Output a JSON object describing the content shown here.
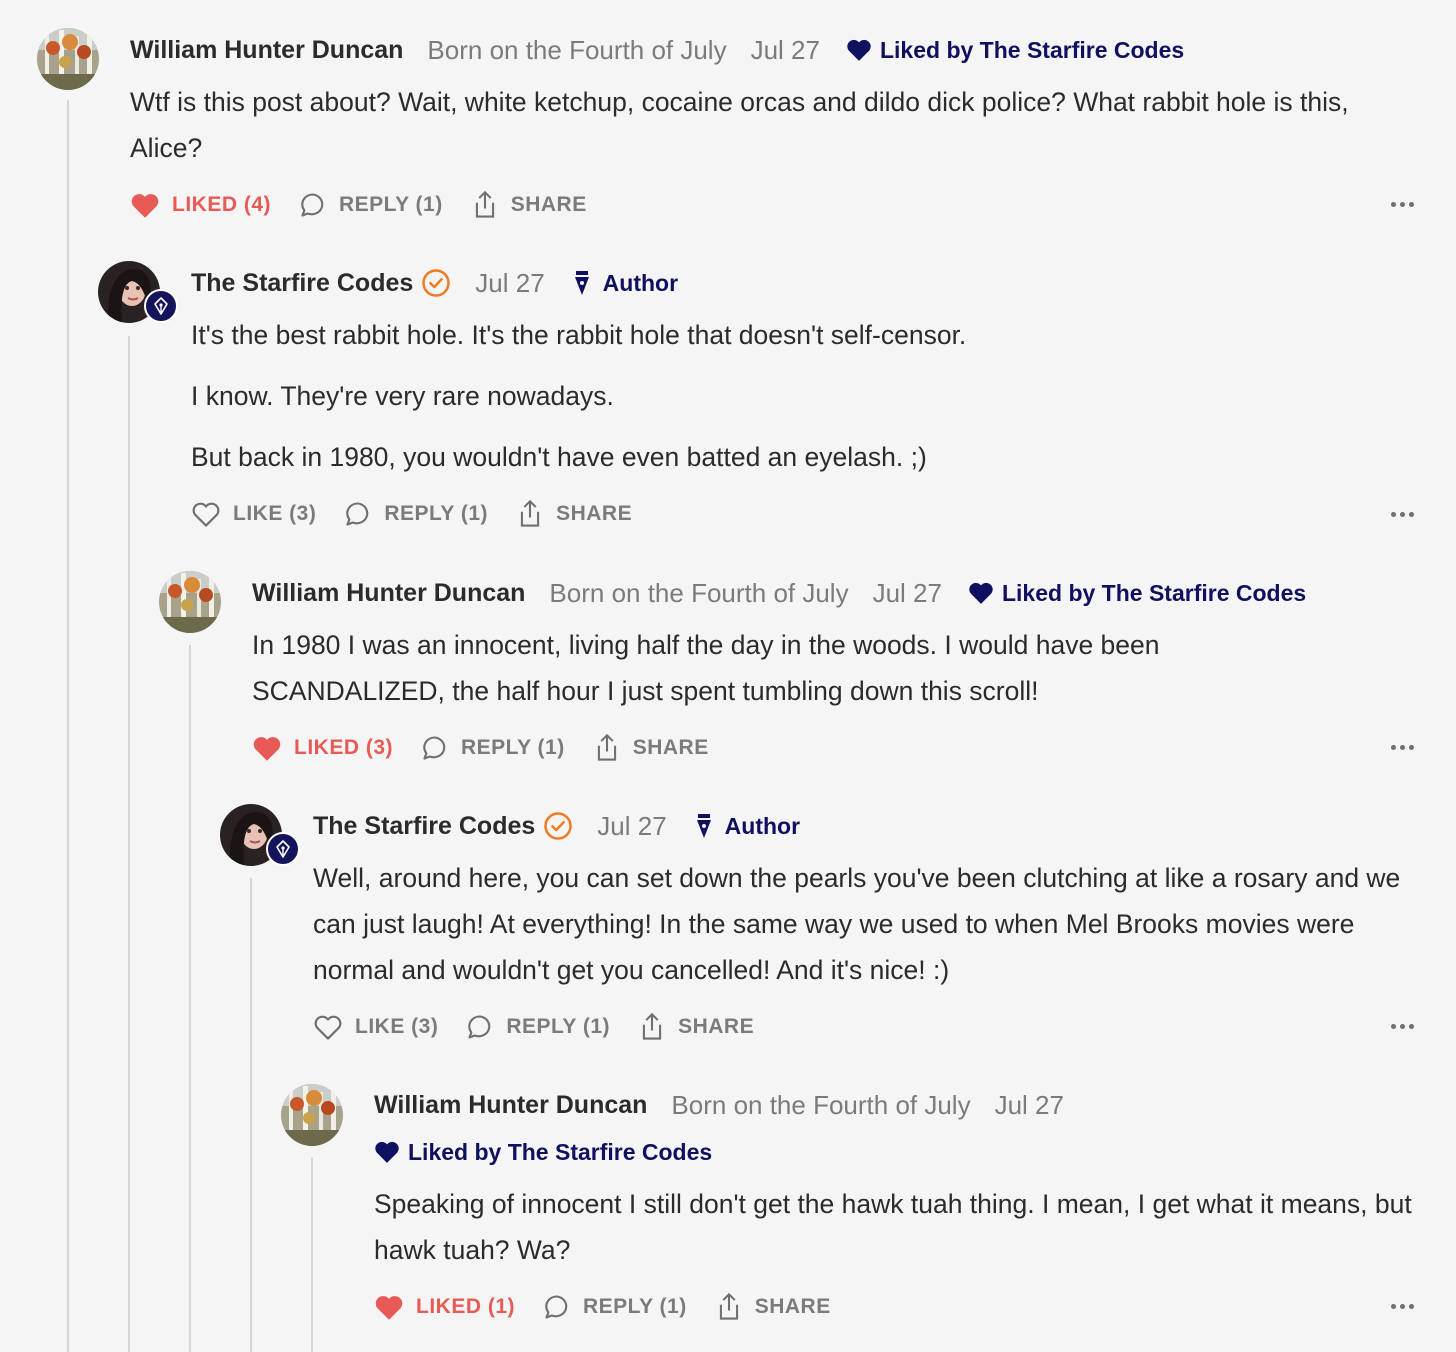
{
  "colors": {
    "background": "#f5f5f5",
    "liked": "#e85a55",
    "navy": "#101060",
    "muted": "#7b7b7b",
    "verified": "#f07a20"
  },
  "comments": [
    {
      "author": "William Hunter Duncan",
      "subtitle": "Born on the Fourth of July",
      "date": "Jul 27",
      "liked_by": "Liked by The Starfire Codes",
      "paragraphs": [
        "Wtf is this post about? Wait, white ketchup, cocaine orcas and dildo dick police? What rabbit hole is this, Alice?"
      ],
      "like_label": "LIKED (4)",
      "liked": true,
      "reply_label": "REPLY (1)",
      "share_label": "SHARE"
    },
    {
      "author": "The Starfire Codes",
      "date": "Jul 27",
      "author_tag": "Author",
      "paragraphs": [
        "It's the best rabbit hole. It's the rabbit hole that doesn't self-censor.",
        "I know. They're very rare nowadays.",
        "But back in 1980, you wouldn't have even batted an eyelash. ;)"
      ],
      "like_label": "LIKE (3)",
      "liked": false,
      "reply_label": "REPLY (1)",
      "share_label": "SHARE"
    },
    {
      "author": "William Hunter Duncan",
      "subtitle": "Born on the Fourth of July",
      "date": "Jul 27",
      "liked_by": "Liked by The Starfire Codes",
      "paragraphs": [
        "In 1980 I was an innocent, living half the day in the woods. I would have been SCANDALIZED, the half hour I just spent tumbling down this scroll!"
      ],
      "like_label": "LIKED (3)",
      "liked": true,
      "reply_label": "REPLY (1)",
      "share_label": "SHARE"
    },
    {
      "author": "The Starfire Codes",
      "date": "Jul 27",
      "author_tag": "Author",
      "paragraphs": [
        "Well, around here, you can set down the pearls you've been clutching at like a rosary and we can just laugh! At everything! In the same way we used to when Mel Brooks movies were normal and wouldn't get you cancelled! And it's nice! :)"
      ],
      "like_label": "LIKE (3)",
      "liked": false,
      "reply_label": "REPLY (1)",
      "share_label": "SHARE"
    },
    {
      "author": "William Hunter Duncan",
      "subtitle": "Born on the Fourth of July",
      "date": "Jul 27",
      "liked_by": "Liked by The Starfire Codes",
      "paragraphs": [
        "Speaking of innocent I still don't get the hawk tuah thing. I mean, I get what it means, but hawk tuah? Wa?"
      ],
      "like_label": "LIKED (1)",
      "liked": true,
      "reply_label": "REPLY (1)",
      "share_label": "SHARE"
    }
  ]
}
